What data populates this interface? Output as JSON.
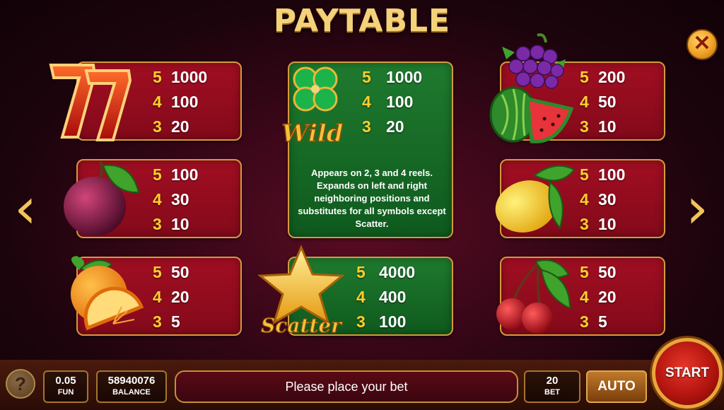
{
  "title": "PAYTABLE",
  "close_glyph": "✕",
  "nav": {
    "prev_glyph": "‹",
    "next_glyph": "›"
  },
  "cards": {
    "sevens": {
      "icon": "lucky-seven-icon",
      "pays": [
        {
          "count": "5",
          "value": "1000"
        },
        {
          "count": "4",
          "value": "100"
        },
        {
          "count": "3",
          "value": "20"
        }
      ]
    },
    "wild": {
      "icon": "clover-wild-icon",
      "label": "Wild",
      "pays": [
        {
          "count": "5",
          "value": "1000"
        },
        {
          "count": "4",
          "value": "100"
        },
        {
          "count": "3",
          "value": "20"
        }
      ],
      "description": "Appears on 2, 3 and 4 reels. Expands on left and right neighboring positions and substitutes for all symbols except Scatter."
    },
    "grapes": {
      "icon": "grapes-watermelon-icon",
      "pays": [
        {
          "count": "5",
          "value": "200"
        },
        {
          "count": "4",
          "value": "50"
        },
        {
          "count": "3",
          "value": "10"
        }
      ]
    },
    "plum": {
      "icon": "plum-icon",
      "pays": [
        {
          "count": "5",
          "value": "100"
        },
        {
          "count": "4",
          "value": "30"
        },
        {
          "count": "3",
          "value": "10"
        }
      ]
    },
    "lemon": {
      "icon": "lemon-icon",
      "pays": [
        {
          "count": "5",
          "value": "100"
        },
        {
          "count": "4",
          "value": "30"
        },
        {
          "count": "3",
          "value": "10"
        }
      ]
    },
    "orange": {
      "icon": "orange-icon",
      "pays": [
        {
          "count": "5",
          "value": "50"
        },
        {
          "count": "4",
          "value": "20"
        },
        {
          "count": "3",
          "value": "5"
        }
      ]
    },
    "scatter": {
      "icon": "star-scatter-icon",
      "label": "Scatter",
      "pays": [
        {
          "count": "5",
          "value": "4000"
        },
        {
          "count": "4",
          "value": "400"
        },
        {
          "count": "3",
          "value": "100"
        }
      ]
    },
    "cherry": {
      "icon": "cherry-icon",
      "pays": [
        {
          "count": "5",
          "value": "50"
        },
        {
          "count": "4",
          "value": "20"
        },
        {
          "count": "3",
          "value": "5"
        }
      ]
    }
  },
  "bottom": {
    "help_glyph": "?",
    "coin_value": "0.05",
    "coin_label": "FUN",
    "balance_value": "58940076",
    "balance_label": "BALANCE",
    "message": "Please place your bet",
    "bet_value": "20",
    "bet_label": "BET",
    "auto_label": "AUTO",
    "start_label": "START"
  },
  "colors": {
    "card_red": "#9a0d20",
    "card_green": "#1a6e28",
    "gold_border": "#d59a3c",
    "count_yellow": "#ffcf2a"
  }
}
